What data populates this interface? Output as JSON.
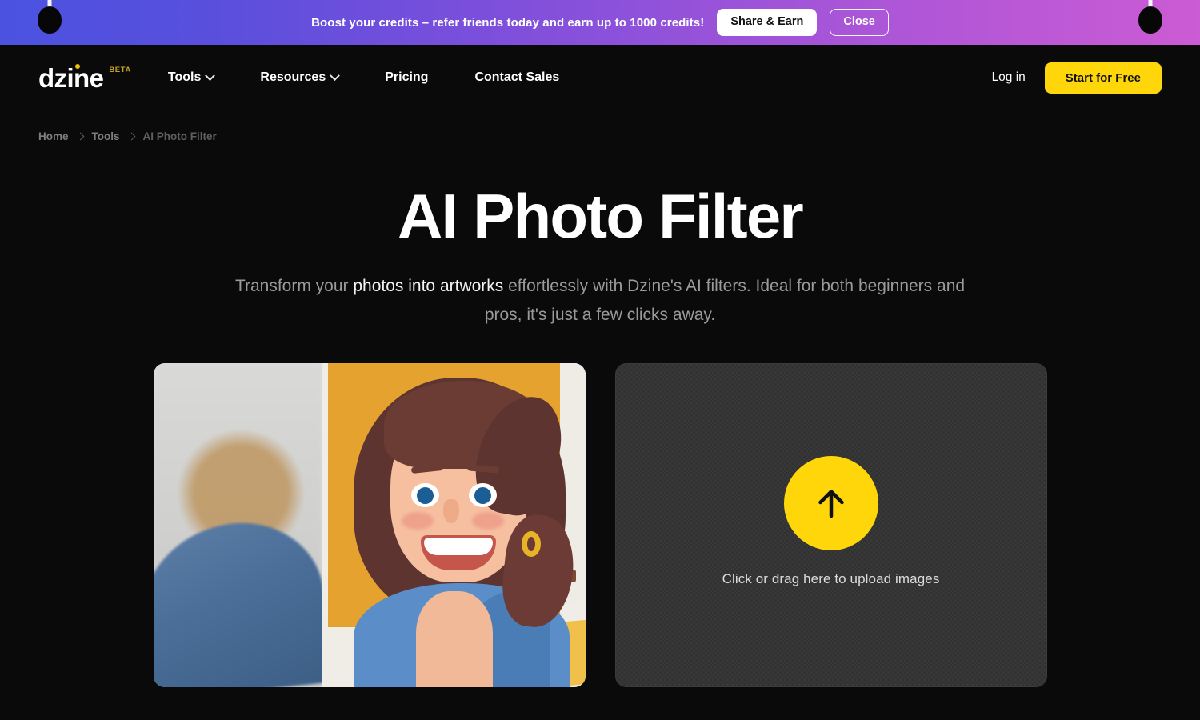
{
  "promo": {
    "message": "Boost your credits – refer friends today and earn up to 1000 credits!",
    "share_label": "Share & Earn",
    "close_label": "Close",
    "gradient_start": "#4B52E0",
    "gradient_end": "#CC5BD4"
  },
  "header": {
    "logo_text": "dzine",
    "logo_badge": "BETA",
    "nav": [
      {
        "label": "Tools",
        "has_dropdown": true
      },
      {
        "label": "Resources",
        "has_dropdown": true
      },
      {
        "label": "Pricing",
        "has_dropdown": false
      },
      {
        "label": "Contact Sales",
        "has_dropdown": false
      }
    ],
    "login_label": "Log in",
    "cta_label": "Start for Free",
    "cta_color": "#FFD60A"
  },
  "breadcrumb": [
    {
      "label": "Home"
    },
    {
      "label": "Tools"
    },
    {
      "label": "AI Photo Filter"
    }
  ],
  "hero": {
    "title": "AI Photo Filter",
    "subtitle_part1": "Transform your ",
    "subtitle_highlight": "photos into artworks",
    "subtitle_part2": " effortlessly with Dzine's AI filters. Ideal for both beginners and pros, it's just a few clicks away."
  },
  "preview": {
    "alt": "Before and after comparison: photo of a smiling woman transformed into an illustrated artwork"
  },
  "dropzone": {
    "label": "Click or drag here to upload images",
    "icon": "upload-arrow-icon",
    "accent_color": "#FFD60A"
  }
}
